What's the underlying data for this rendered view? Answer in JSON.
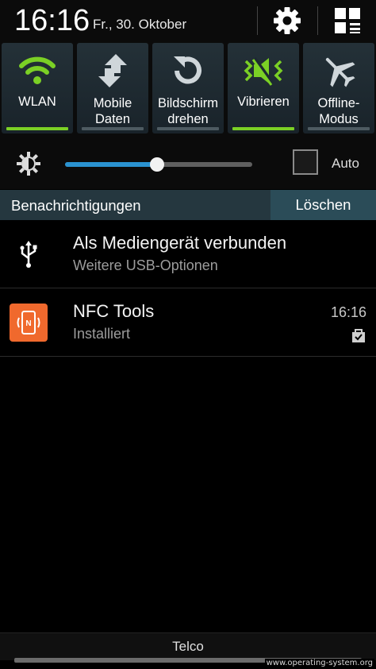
{
  "header": {
    "time": "16:16",
    "date": "Fr., 30. Oktober"
  },
  "toggles": [
    {
      "label": "WLAN",
      "icon": "wifi-icon",
      "on": true
    },
    {
      "label": "Mobile Daten",
      "icon": "mobile-data-icon",
      "on": false
    },
    {
      "label": "Bildschirm drehen",
      "icon": "rotate-icon",
      "on": false
    },
    {
      "label": "Vibrieren",
      "icon": "vibrate-icon",
      "on": true
    },
    {
      "label": "Offline-Modus",
      "icon": "airplane-icon",
      "on": false
    }
  ],
  "brightness": {
    "level": 0.49,
    "auto_label": "Auto",
    "auto_checked": false
  },
  "notifications_header": {
    "title": "Benachrichtigungen",
    "clear_label": "Löschen"
  },
  "notifications": [
    {
      "title": "Als Mediengerät verbunden",
      "subtitle": "Weitere USB-Optionen",
      "icon": "usb-icon"
    },
    {
      "title": "NFC Tools",
      "subtitle": "Installiert",
      "time": "16:16",
      "icon": "nfc-tools-app-icon",
      "badge_icon": "store-bag-icon"
    }
  ],
  "carrier": "Telco",
  "watermark": "www.operating-system.org",
  "colors": {
    "accent_green": "#7bd025",
    "slider_blue": "#2a92d0",
    "header_teal": "#25373f",
    "nfc_orange": "#f0692d"
  }
}
